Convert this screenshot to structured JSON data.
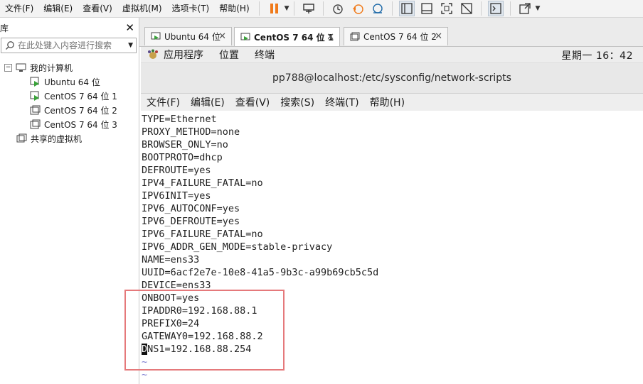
{
  "menubar": {
    "items": [
      "文件(F)",
      "编辑(E)",
      "查看(V)",
      "虚拟机(M)",
      "选项卡(T)",
      "帮助(H)"
    ]
  },
  "toolbar": {
    "icons": [
      "pause-icon",
      "send-keys-icon",
      "snapshot-icon",
      "revert-snapshot-icon",
      "snapshot-manager-icon",
      "sidebar-view-icon",
      "console-view-icon",
      "fullscreen-icon",
      "unity-icon",
      "terminal-icon",
      "stretch-icon"
    ],
    "accent": "#f07a1a"
  },
  "library": {
    "title": "库",
    "search_placeholder": "在此处键入内容进行搜索",
    "root": "我的计算机",
    "vms": [
      "Ubuntu 64 位",
      "CentOS 7 64 位 1",
      "CentOS 7 64 位 2",
      "CentOS 7 64 位 3"
    ],
    "shared": "共享的虚拟机"
  },
  "tabs": [
    {
      "label": "Ubuntu 64 位",
      "active": false
    },
    {
      "label": "CentOS 7 64 位 1",
      "active": true
    },
    {
      "label": "CentOS 7 64 位 2",
      "active": false
    }
  ],
  "gnome": {
    "apps": "应用程序",
    "places": "位置",
    "terminal": "终端",
    "clock": "星期一 16：42"
  },
  "terminal": {
    "title": "pp788@localhost:/etc/sysconfig/network-scripts",
    "menu": [
      "文件(F)",
      "编辑(E)",
      "查看(V)",
      "搜索(S)",
      "终端(T)",
      "帮助(H)"
    ],
    "lines": [
      "TYPE=Ethernet",
      "PROXY_METHOD=none",
      "BROWSER_ONLY=no",
      "BOOTPROTO=dhcp",
      "DEFROUTE=yes",
      "IPV4_FAILURE_FATAL=no",
      "IPV6INIT=yes",
      "IPV6_AUTOCONF=yes",
      "IPV6_DEFROUTE=yes",
      "IPV6_FAILURE_FATAL=no",
      "IPV6_ADDR_GEN_MODE=stable-privacy",
      "NAME=ens33",
      "UUID=6acf2e7e-10e8-41a5-9b3c-a99b69cb5c5d",
      "DEVICE=ens33",
      "ONBOOT=yes",
      "IPADDR0=192.168.88.1",
      "PREFIX0=24",
      "GATEWAY0=192.168.88.2"
    ],
    "cursor_char": "D",
    "last_line_rest": "NS1=192.168.88.254",
    "tilde": "~"
  },
  "colors": {
    "highlight_box": "#e5797b",
    "tilde": "#7b7bd0"
  }
}
